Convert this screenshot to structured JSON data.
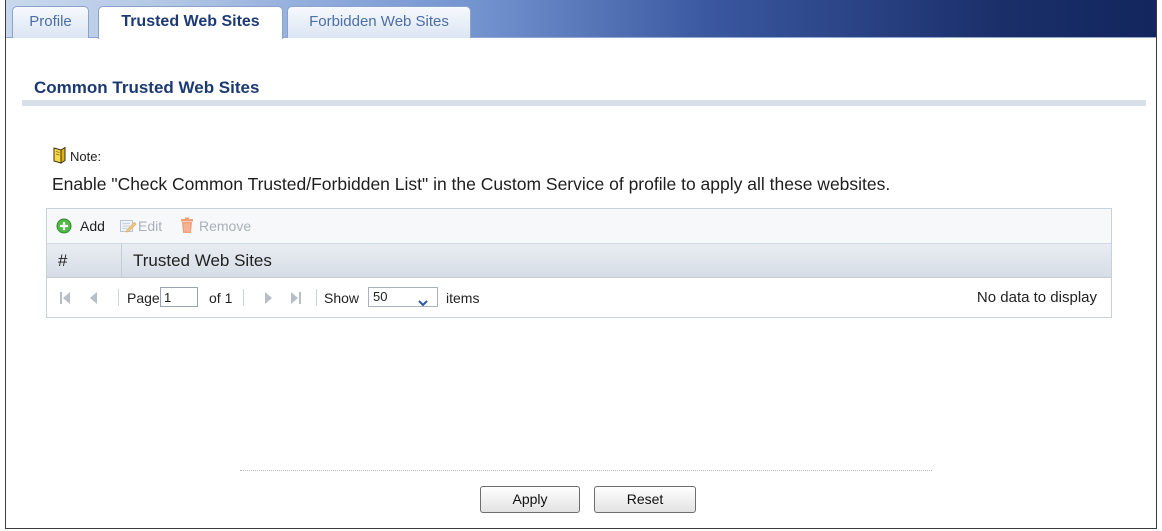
{
  "tabs": [
    {
      "label": "Profile",
      "active": false
    },
    {
      "label": "Trusted Web Sites",
      "active": true
    },
    {
      "label": "Forbidden Web Sites",
      "active": false
    }
  ],
  "section": {
    "title": "Common Trusted Web Sites"
  },
  "note": {
    "icon": "note-icon",
    "label": "Note:",
    "text": "Enable \"Check Common Trusted/Forbidden List\" in the Custom Service of profile to apply all these websites."
  },
  "toolbar": {
    "add": {
      "label": "Add",
      "icon": "add-icon",
      "enabled": true
    },
    "edit": {
      "label": "Edit",
      "icon": "edit-icon",
      "enabled": false
    },
    "remove": {
      "label": "Remove",
      "icon": "trash-icon",
      "enabled": false
    }
  },
  "table": {
    "columns": [
      "#",
      "Trusted Web Sites"
    ],
    "rows": []
  },
  "pager": {
    "page_label": "Page",
    "page_value": "1",
    "of_label": "of 1",
    "show_label": "Show",
    "per_page": "50",
    "items_label": "items",
    "status": "No data to display"
  },
  "buttons": {
    "apply": "Apply",
    "reset": "Reset"
  },
  "colors": {
    "heading": "#1c3a72",
    "active_tab_text": "#1d3a76",
    "inactive_tab_text": "#4d6ea6",
    "tab_bar_dark": "#13265d",
    "disabled_text": "#a9b0b9"
  }
}
